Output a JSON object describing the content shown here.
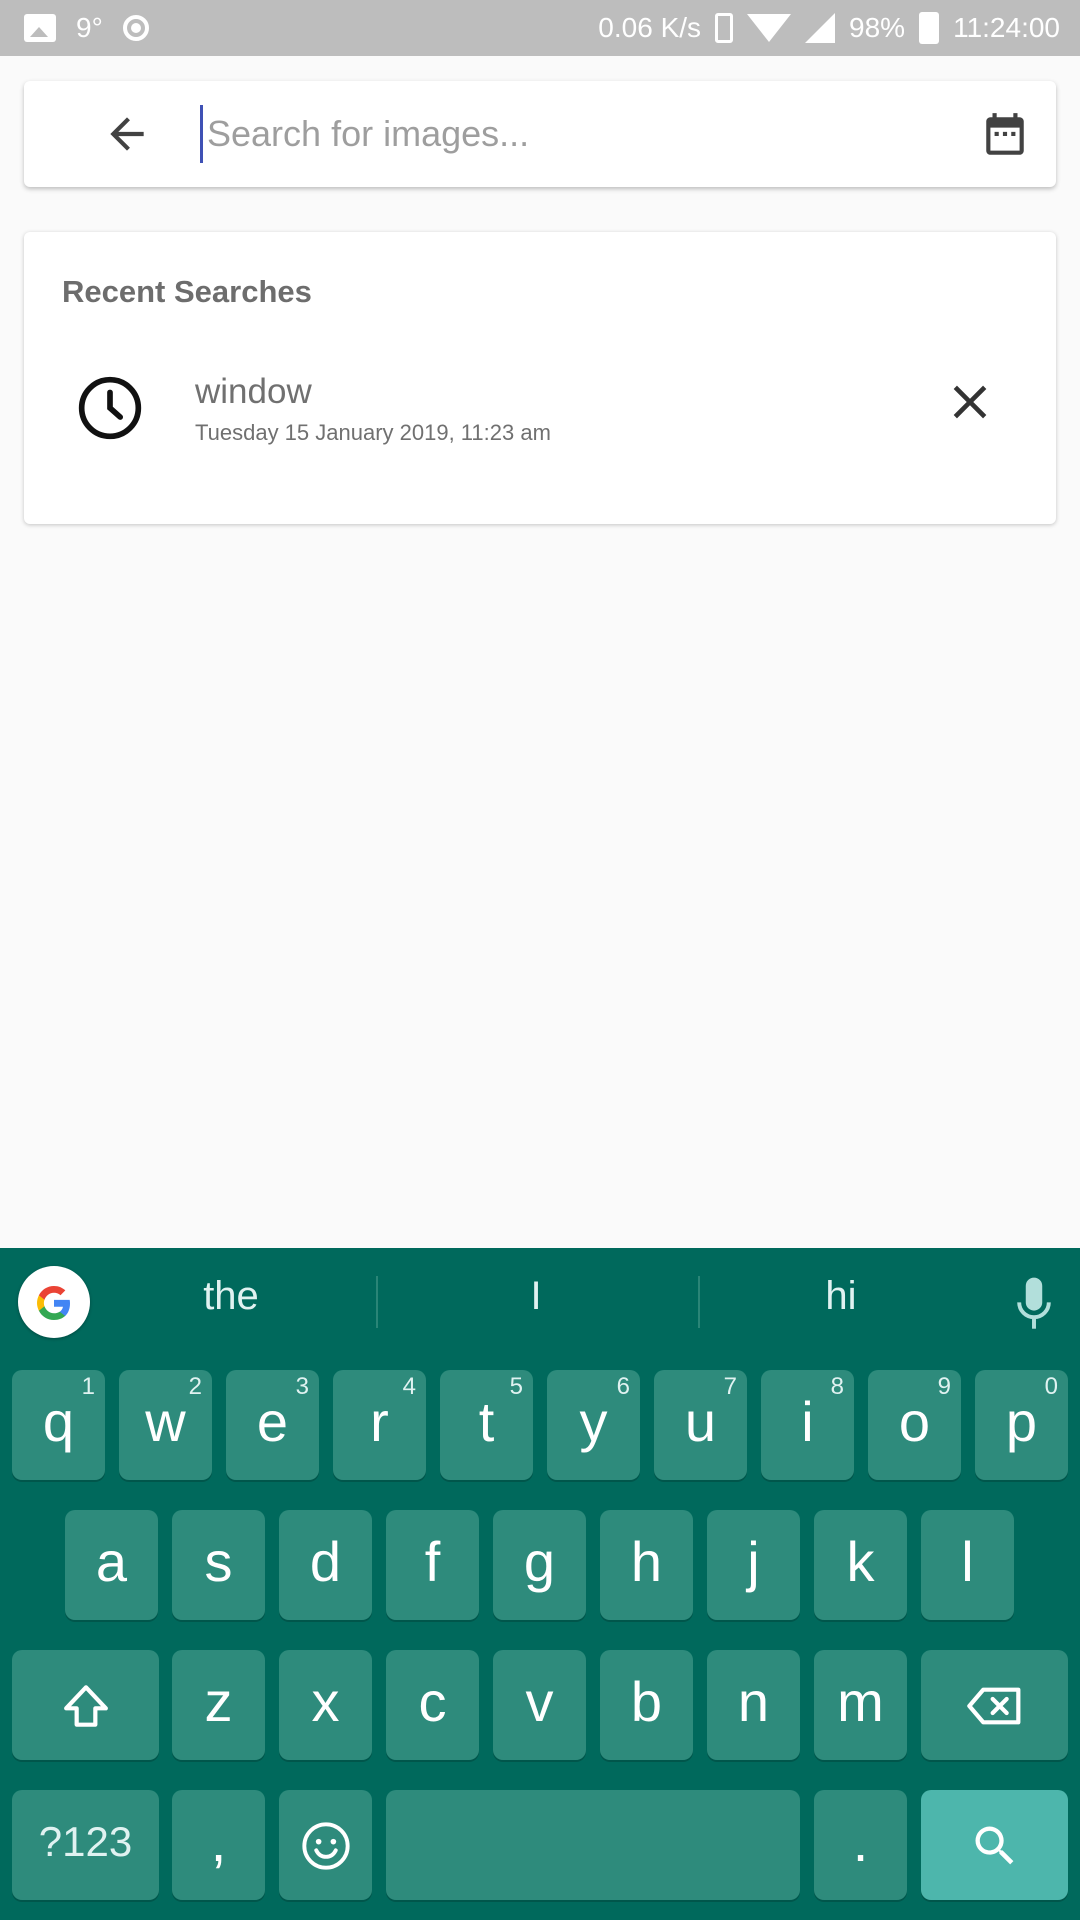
{
  "status_bar": {
    "temperature": "9°",
    "net_speed": "0.06 K/s",
    "battery": "98%",
    "time": "11:24:00",
    "icons": [
      "picture-icon",
      "circle-icon",
      "vibrate-icon",
      "wifi-icon",
      "signal-icon",
      "battery-charging-icon"
    ]
  },
  "search": {
    "placeholder": "Search for images...",
    "value": "",
    "back_icon": "arrow-left-icon",
    "calendar_icon": "calendar-icon"
  },
  "recent": {
    "title": "Recent Searches",
    "items": [
      {
        "term": "window",
        "date": "Tuesday 15 January 2019, 11:23 am",
        "icon": "clock-icon",
        "remove_icon": "close-icon"
      }
    ]
  },
  "keyboard": {
    "colors": {
      "background": "#00695c",
      "key": "#2e8b7c",
      "action_key": "#4db6ac"
    },
    "suggestions": [
      "the",
      "I",
      "hi"
    ],
    "row1": [
      {
        "k": "q",
        "h": "1"
      },
      {
        "k": "w",
        "h": "2"
      },
      {
        "k": "e",
        "h": "3"
      },
      {
        "k": "r",
        "h": "4"
      },
      {
        "k": "t",
        "h": "5"
      },
      {
        "k": "y",
        "h": "6"
      },
      {
        "k": "u",
        "h": "7"
      },
      {
        "k": "i",
        "h": "8"
      },
      {
        "k": "o",
        "h": "9"
      },
      {
        "k": "p",
        "h": "0"
      }
    ],
    "row2": [
      "a",
      "s",
      "d",
      "f",
      "g",
      "h",
      "j",
      "k",
      "l"
    ],
    "row3": [
      "z",
      "x",
      "c",
      "v",
      "b",
      "n",
      "m"
    ],
    "row4": {
      "symbols": "?123",
      "comma": ",",
      "period": "."
    }
  }
}
